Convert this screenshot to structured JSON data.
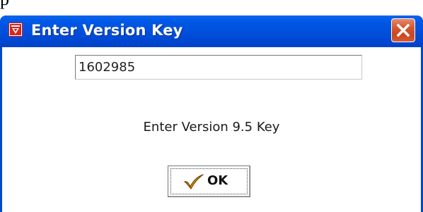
{
  "background_strip": {
    "text": "p"
  },
  "dialog": {
    "title": "Enter Version Key",
    "title_icon": "app-logo-icon",
    "close_icon": "close-icon",
    "key_field": {
      "value": "1602985"
    },
    "prompt": "Enter Version 9.5 Key",
    "ok_button": {
      "label": "OK",
      "icon": "checkmark-icon"
    }
  },
  "colors": {
    "titlebar": "#0050dd",
    "close_button": "#d65a35",
    "checkmark": "#e6a21a"
  }
}
